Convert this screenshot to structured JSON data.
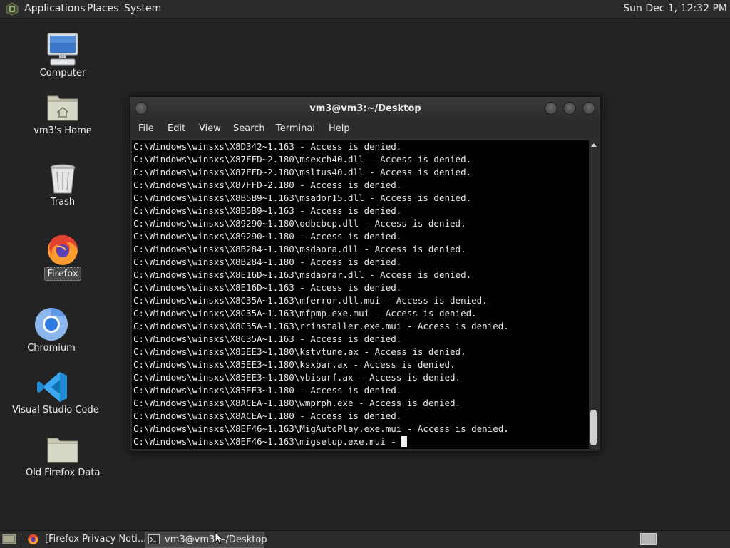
{
  "top_panel": {
    "menus": [
      "Applications",
      "Places",
      "System"
    ],
    "clock": "Sun Dec 1, 12:32 PM"
  },
  "desktop": {
    "icons": [
      {
        "label": "Computer",
        "icon": "computer-icon"
      },
      {
        "label": "vm3's Home",
        "icon": "home-folder-icon"
      },
      {
        "label": "Trash",
        "icon": "trash-icon"
      },
      {
        "label": "Firefox",
        "icon": "firefox-icon",
        "selected": true
      },
      {
        "label": "Chromium",
        "icon": "chromium-icon"
      },
      {
        "label": "Visual Studio Code",
        "icon": "vscode-icon"
      },
      {
        "label": "Old Firefox Data",
        "icon": "folder-icon"
      }
    ]
  },
  "terminal": {
    "title": "vm3@vm3:~/Desktop",
    "menu": [
      "File",
      "Edit",
      "View",
      "Search",
      "Terminal",
      "Help"
    ],
    "lines": [
      "C:\\Windows\\winsxs\\X8D342~1.163 - Access is denied.",
      "C:\\Windows\\winsxs\\X87FFD~2.180\\msexch40.dll - Access is denied.",
      "C:\\Windows\\winsxs\\X87FFD~2.180\\msltus40.dll - Access is denied.",
      "C:\\Windows\\winsxs\\X87FFD~2.180 - Access is denied.",
      "C:\\Windows\\winsxs\\X8B5B9~1.163\\msador15.dll - Access is denied.",
      "C:\\Windows\\winsxs\\X8B5B9~1.163 - Access is denied.",
      "C:\\Windows\\winsxs\\X89290~1.180\\odbcbcp.dll - Access is denied.",
      "C:\\Windows\\winsxs\\X89290~1.180 - Access is denied.",
      "C:\\Windows\\winsxs\\X8B284~1.180\\msdaora.dll - Access is denied.",
      "C:\\Windows\\winsxs\\X8B284~1.180 - Access is denied.",
      "C:\\Windows\\winsxs\\X8E16D~1.163\\msdaorar.dll - Access is denied.",
      "C:\\Windows\\winsxs\\X8E16D~1.163 - Access is denied.",
      "C:\\Windows\\winsxs\\X8C35A~1.163\\mferror.dll.mui - Access is denied.",
      "C:\\Windows\\winsxs\\X8C35A~1.163\\mfpmp.exe.mui - Access is denied.",
      "C:\\Windows\\winsxs\\X8C35A~1.163\\rrinstaller.exe.mui - Access is denied.",
      "C:\\Windows\\winsxs\\X8C35A~1.163 - Access is denied.",
      "C:\\Windows\\winsxs\\X85EE3~1.180\\kstvtune.ax - Access is denied.",
      "C:\\Windows\\winsxs\\X85EE3~1.180\\ksxbar.ax - Access is denied.",
      "C:\\Windows\\winsxs\\X85EE3~1.180\\vbisurf.ax - Access is denied.",
      "C:\\Windows\\winsxs\\X85EE3~1.180 - Access is denied.",
      "C:\\Windows\\winsxs\\X8ACEA~1.180\\wmprph.exe - Access is denied.",
      "C:\\Windows\\winsxs\\X8ACEA~1.180 - Access is denied.",
      "C:\\Windows\\winsxs\\X8EF46~1.163\\MigAutoPlay.exe.mui - Access is denied."
    ],
    "prompt_line": "C:\\Windows\\winsxs\\X8EF46~1.163\\migsetup.exe.mui - "
  },
  "taskbar": {
    "tasks": [
      {
        "label": "[Firefox Privacy Noti...",
        "icon": "firefox-icon",
        "active": false
      },
      {
        "label": "vm3@vm3:~/Desktop",
        "icon": "terminal-icon",
        "active": true
      }
    ]
  }
}
